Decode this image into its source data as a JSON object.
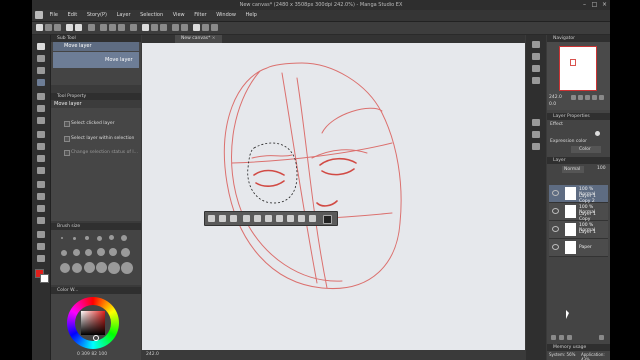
{
  "window": {
    "title": "New canvas* (2480 x 3508px 300dpi 242.0%)",
    "app_name": "Manga Studio EX"
  },
  "menu": [
    "File",
    "Edit",
    "Story(P)",
    "Layer",
    "Selection",
    "View",
    "Filter",
    "Window",
    "Help"
  ],
  "sub_tool": {
    "title": "Sub Tool",
    "group_label": "Move layer",
    "item_label": "Move layer"
  },
  "tool_property": {
    "title": "Tool Property",
    "tool_name": "Move layer",
    "options": [
      "Select clicked layer",
      "Select layer within selection",
      "Change selection status of l..."
    ]
  },
  "brush_size": {
    "title": "Brush size"
  },
  "color_wheel": {
    "title": "Color W...",
    "hsv_readout": "0  309  82  100"
  },
  "canvas": {
    "tab_label": "New canvas*",
    "status_zoom": "242.0"
  },
  "navigator": {
    "title": "Navigator",
    "zoom": "242.0",
    "angle": "0.0"
  },
  "layer_property": {
    "title": "Layer Properties",
    "effect_label": "Effect",
    "expression_color_label": "Expression color",
    "color_value": "Color"
  },
  "layer_panel": {
    "title": "Layer",
    "blend_mode": "Normal",
    "opacity": "100",
    "layers": [
      {
        "opacity": "100 %",
        "mode": "Normal",
        "name": "Layer 1 Copy 2",
        "visible": true,
        "selected": true
      },
      {
        "opacity": "100 %",
        "mode": "Normal",
        "name": "Layer 1 Copy",
        "visible": true,
        "selected": false
      },
      {
        "opacity": "100 %",
        "mode": "Normal",
        "name": "Layer 1",
        "visible": true,
        "selected": false
      },
      {
        "name": "Paper",
        "visible": true,
        "selected": false
      }
    ]
  },
  "memory": {
    "title": "Memory usage",
    "system": "System: 56%",
    "application": "Application: 43%"
  },
  "colors": {
    "accent_selection": "#5e6c82",
    "sketch_red": "#d9534f",
    "main_color": "#e0201c"
  }
}
